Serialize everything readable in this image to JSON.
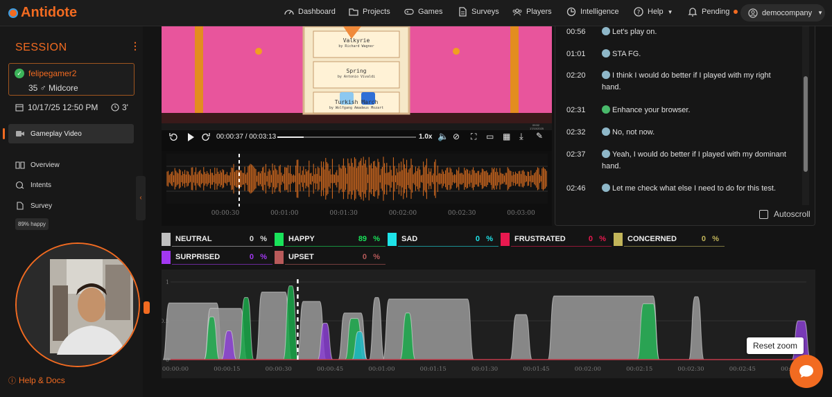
{
  "app": {
    "name": "Antidote"
  },
  "nav": [
    {
      "label": "Dashboard",
      "icon": "dashboard-icon"
    },
    {
      "label": "Projects",
      "icon": "folder-icon"
    },
    {
      "label": "Games",
      "icon": "gamepad-icon"
    },
    {
      "label": "Surveys",
      "icon": "document-icon"
    },
    {
      "label": "Players",
      "icon": "players-icon"
    },
    {
      "label": "Intelligence",
      "icon": "intelligence-icon"
    },
    {
      "label": "Help",
      "icon": "help-icon"
    },
    {
      "label": "Pending",
      "icon": "bell-icon"
    }
  ],
  "account": {
    "name": "democompany"
  },
  "session": {
    "title": "SESSION",
    "player_name": "felipegamer2",
    "player_info": "35 ♂ Midcore",
    "datetime": "10/17/25 12:50 PM",
    "duration": "3'"
  },
  "sidebar": {
    "active": "Gameplay Video",
    "items": [
      "Overview",
      "Intents",
      "Survey"
    ],
    "chip": "89% happy",
    "help": "Help & Docs"
  },
  "game": {
    "tracks": [
      {
        "title": "Valkyrie",
        "by": "by Richard Wagner"
      },
      {
        "title": "Spring",
        "by": "by Antonio Vivaldi"
      },
      {
        "title": "Turkish March",
        "by": "by Wolfgang Amadeus Mozart"
      }
    ],
    "taskbar_time": "09:52",
    "taskbar_date": "17/10/2025"
  },
  "player": {
    "time": "00:00:37 / 00:03:13",
    "speed": "1.0x",
    "progress": 0.19
  },
  "waveform": {
    "ticks": [
      "00:00:30",
      "00:01:00",
      "00:01:30",
      "00:02:00",
      "00:02:30",
      "00:03:00"
    ]
  },
  "transcript": [
    {
      "time": "00:56",
      "text": "Let's play on.",
      "face": "neutral"
    },
    {
      "time": "01:01",
      "text": "STA FG.",
      "face": "neutral"
    },
    {
      "time": "02:20",
      "text": "I think I would do better if I played with my right hand.",
      "face": "neutral"
    },
    {
      "time": "02:31",
      "text": "Enhance your browser.",
      "face": "happy"
    },
    {
      "time": "02:32",
      "text": "No, not now.",
      "face": "neutral"
    },
    {
      "time": "02:37",
      "text": "Yeah, I would do better if I played with my dominant hand.",
      "face": "neutral"
    },
    {
      "time": "02:46",
      "text": "Let me check what else I need to do for this test.",
      "face": "neutral"
    }
  ],
  "autoscroll": "Autoscroll",
  "emotions": [
    {
      "name": "NEUTRAL",
      "value": "0",
      "color": "#bfbfbf"
    },
    {
      "name": "HAPPY",
      "value": "89",
      "color": "#19e35a"
    },
    {
      "name": "SAD",
      "value": "0",
      "color": "#1ee3e8"
    },
    {
      "name": "FRUSTRATED",
      "value": "0",
      "color": "#e8194f"
    },
    {
      "name": "CONCERNED",
      "value": "0",
      "color": "#c2b55a"
    },
    {
      "name": "SURPRISED",
      "value": "0",
      "color": "#a238f2"
    },
    {
      "name": "UPSET",
      "value": "0",
      "color": "#b85a5a"
    }
  ],
  "percent": "%",
  "chart_data": {
    "type": "area",
    "ylim": [
      0,
      1
    ],
    "yticks": [
      "0",
      "0.5",
      "1"
    ],
    "x_ticks": [
      "00:00:00",
      "00:00:15",
      "00:00:30",
      "00:00:45",
      "00:01:00",
      "00:01:15",
      "00:01:30",
      "00:01:45",
      "00:02:00",
      "00:02:15",
      "00:02:30",
      "00:02:45",
      "00:03:00"
    ],
    "x_range_seconds": [
      0,
      185
    ],
    "cursor_seconds": 37,
    "series": [
      {
        "color": "#9a9a9a",
        "peaks": [
          [
            0,
            13,
            0.73
          ],
          [
            12,
            20,
            0.66
          ],
          [
            27,
            33,
            0.87
          ],
          [
            39,
            43,
            0.75
          ],
          [
            51,
            55,
            0.6
          ],
          [
            60,
            60,
            0.8
          ],
          [
            64,
            86,
            0.78
          ],
          [
            101,
            103,
            0.58
          ],
          [
            112,
            140,
            0.82
          ],
          [
            153,
            153,
            0.81
          ]
        ]
      },
      {
        "color": "#1aa84a",
        "peaks": [
          [
            12,
            12,
            0.55
          ],
          [
            22,
            22,
            0.8
          ],
          [
            35,
            35,
            0.95
          ],
          [
            53,
            54,
            0.53
          ],
          [
            69,
            69,
            0.6
          ],
          [
            138,
            140,
            0.72
          ]
        ]
      },
      {
        "color": "#8a3fd1",
        "peaks": [
          [
            17,
            17,
            0.37
          ],
          [
            45,
            45,
            0.47
          ],
          [
            183,
            184,
            0.5
          ]
        ]
      },
      {
        "color": "#20b7c4",
        "peaks": [
          [
            55,
            55,
            0.36
          ]
        ]
      }
    ]
  }
}
